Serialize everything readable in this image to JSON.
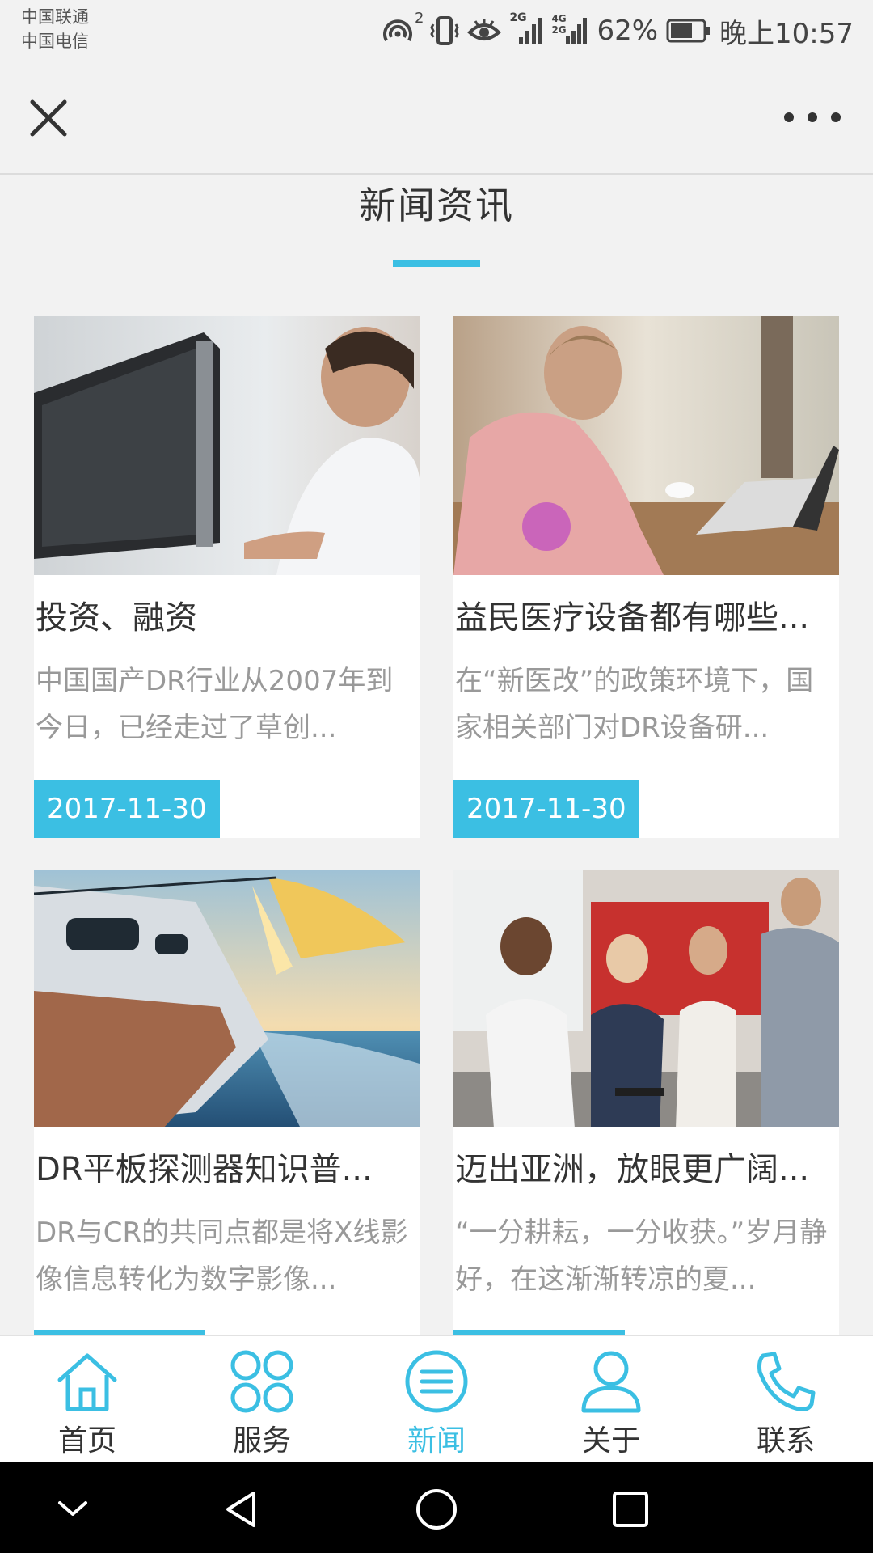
{
  "status_bar": {
    "carrier_1": "中国联通",
    "carrier_2": "中国电信",
    "hotspot_sup": "2",
    "signal_1_label": "2G",
    "signal_2_label": "4G 2G",
    "battery": "62%",
    "time": "晚上10:57"
  },
  "nav": {
    "close_icon": "close-icon",
    "more_icon": "more-dots-icon"
  },
  "section": {
    "title": "新闻资讯"
  },
  "news": [
    {
      "title": "投资、融资",
      "desc": "中国国产DR行业从2007年到今日，已经走过了草创...",
      "date": "2017-11-30",
      "image": "woman-at-monitor-photo"
    },
    {
      "title": "益民医疗设备都有哪些...",
      "desc": "在“新医改”的政策环境下，国家相关部门对DR设备研...",
      "date": "2017-11-30",
      "image": "man-on-phone-with-laptop-photo"
    },
    {
      "title": "DR平板探测器知识普...",
      "desc": "DR与CR的共同点都是将X线影像信息转化为数字影像...",
      "date": "",
      "image": "sailboat-sunset-photo"
    },
    {
      "title": "迈出亚洲，放眼更广阔...",
      "desc": "“一分耕耘，一分收获。”岁月静好，在这渐渐转凉的夏...",
      "date": "",
      "image": "office-group-laughing-photo"
    }
  ],
  "tabs": [
    {
      "label": "首页",
      "icon": "home-icon",
      "active": false
    },
    {
      "label": "服务",
      "icon": "grid-icon",
      "active": false
    },
    {
      "label": "新闻",
      "icon": "news-list-icon",
      "active": true
    },
    {
      "label": "关于",
      "icon": "user-icon",
      "active": false
    },
    {
      "label": "联系",
      "icon": "phone-icon",
      "active": false
    }
  ],
  "colors": {
    "accent": "#3bbfe3",
    "background": "#f2f2f2",
    "card": "#ffffff",
    "title_text": "#333333",
    "desc_text": "#999999"
  }
}
